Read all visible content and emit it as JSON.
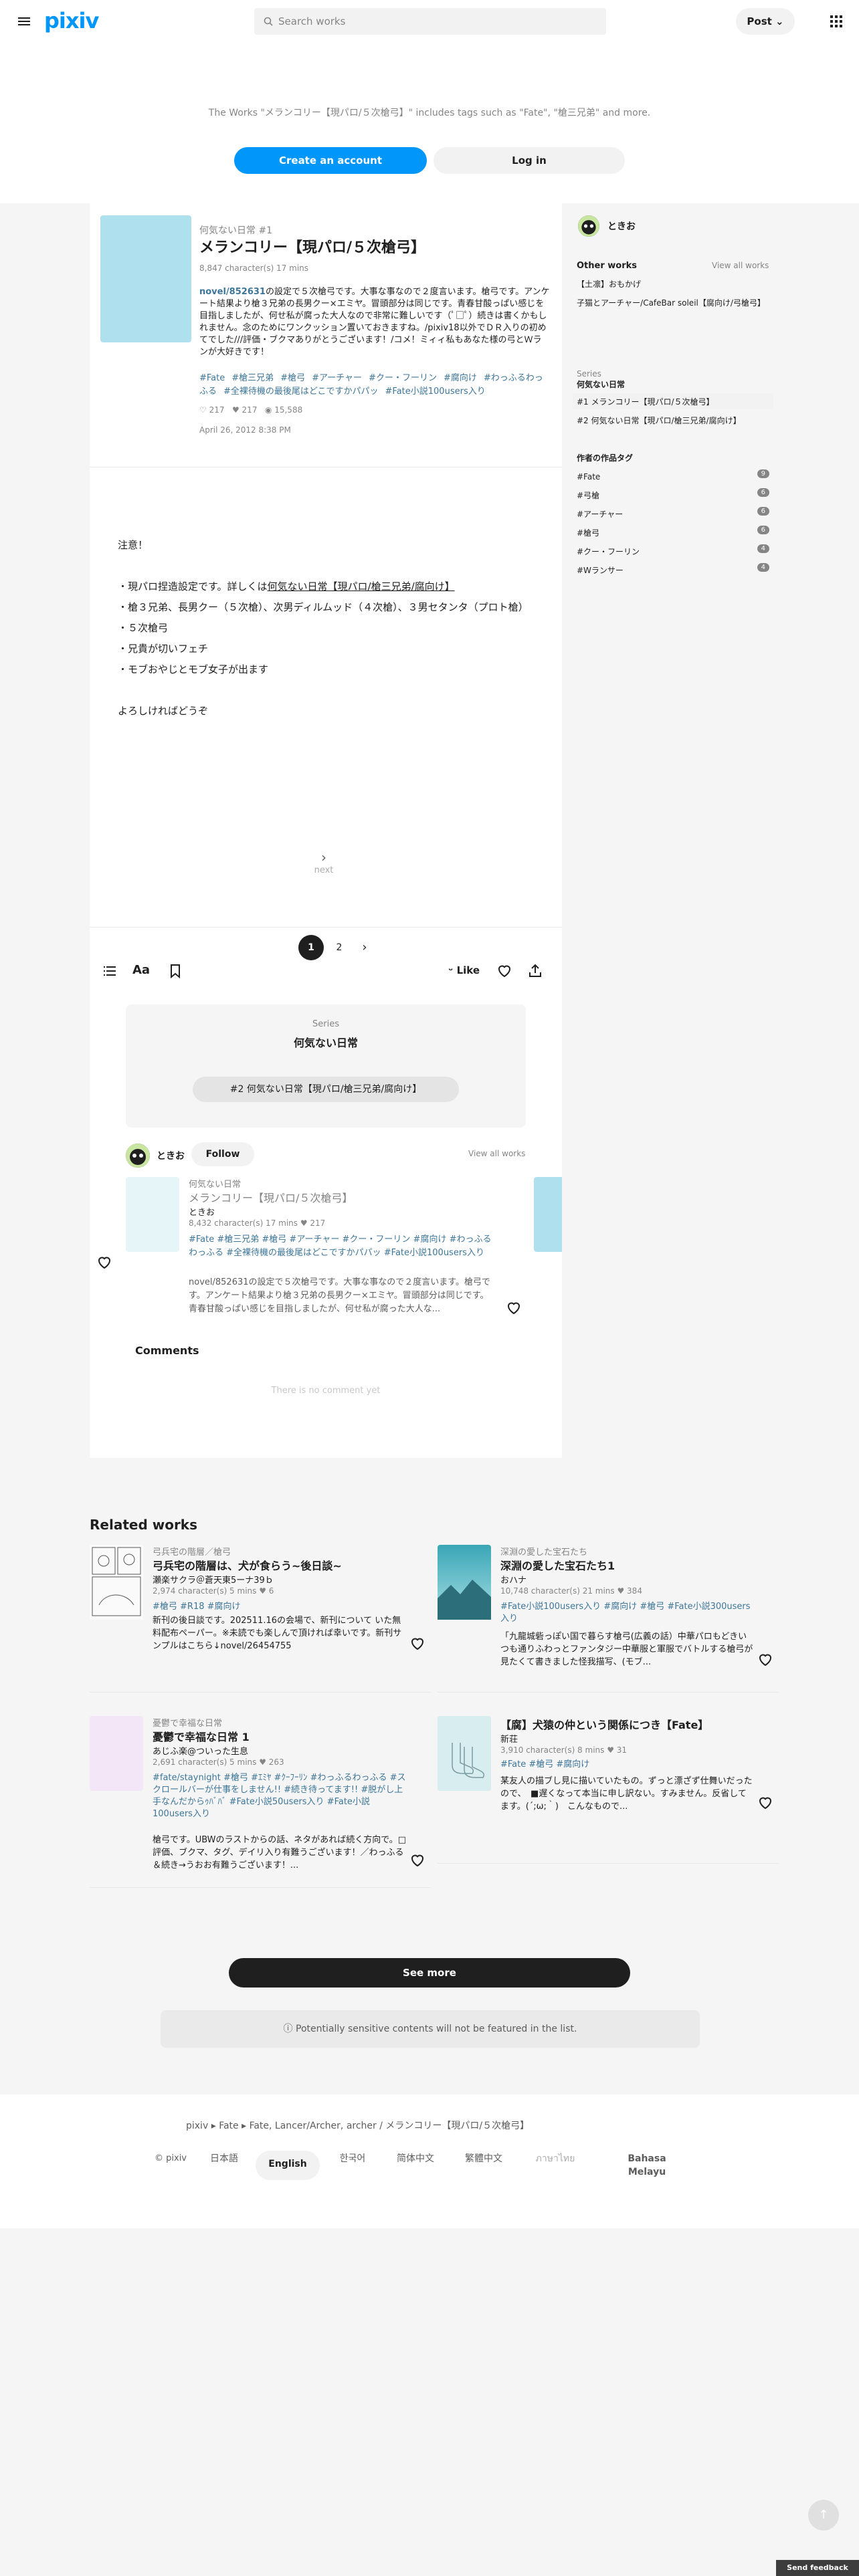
{
  "header": {
    "logo": "pixiv",
    "search_placeholder": "Search works",
    "post_label": "Post"
  },
  "intro": {
    "tagline": "The Works \"メランコリー【現パロ/５次槍弓】\" includes tags such as \"Fate\", \"槍三兄弟\" and more.",
    "create_account": "Create an account",
    "login": "Log in"
  },
  "work": {
    "series_crumb": "何気ない日常 #1",
    "title": "メランコリー【現パロ/５次槍弓】",
    "stats": "8,847 character(s)  17 mins",
    "description_link": "novel/852631",
    "description": "の設定で５次槍弓です。大事な事なので２度言います。槍弓です。アンケート結果より槍３兄弟の長男クー×エミヤ。冒頭部分は同じです。青春甘酸っぱい感じを目指しましたが、何せ私が腐った大人なので非常に難しいです（ﾟ□ﾟ）続きは書くかもしれません。念のためにワンクッション置いておきますね。/pixiv18以外でＤＲ入りの初めてでした///評価・ブクマありがとうございます！/コメ！ミィィ私もあなた様の弓とＷランが大好きです！",
    "tags": [
      "#Fate",
      "#槍三兄弟",
      "#槍弓",
      "#アーチャー",
      "#クー・フーリン",
      "#腐向け",
      "#わっふるわっふる",
      "#全裸待機の最後尾はどこですかパパッ",
      "#Fate小説100users入り"
    ],
    "like_count": "217",
    "bookmark_count": "217",
    "view_count": "15,588",
    "date": "April 26, 2012 8:38 PM",
    "body_lines": [
      "注意！",
      "",
      "・現パロ捏造設定です。詳しくは",
      "・槍３兄弟、長男クー（５次槍）、次男ディルムッド（４次槍）、３男セタンタ（プロト槍）",
      "・５次槍弓",
      "・兄貴が切いフェチ",
      "・モブおやじとモブ女子が出ます",
      "",
      "よろしければどうぞ"
    ],
    "body_link": "何気ない日常【現パロ/槍三兄弟/腐向け】",
    "next_label": "next",
    "page_current": "1",
    "page_next": "2",
    "like_label": "Like"
  },
  "series_box": {
    "label": "Series",
    "name": "何気ない日常",
    "next_item": "#2 何気ない日常【現パロ/槍三兄弟/腐向け】"
  },
  "author": {
    "name": "ときお",
    "follow": "Follow",
    "view_all": "View all works"
  },
  "author_card": {
    "series": "何気ない日常",
    "title": "メランコリー【現パロ/５次槍弓】",
    "author": "ときお",
    "stats": "8,432 character(s)  17 mins  ♥ 217",
    "tags": "#Fate  #槍三兄弟  #槍弓  #アーチャー  #クー・フーリン  #腐向け  #わっふるわっふる  #全裸待機の最後尾はどこですかパパッ  #Fate小説100users入り",
    "excerpt": "novel/852631の設定で５次槍弓です。大事な事なので２度言います。槍弓です。アンケート結果より槍３兄弟の長男クー×エミヤ。冒頭部分は同じです。青春甘酸っぱい感じを目指しましたが、何せ私が腐った大人な..."
  },
  "comments": {
    "title": "Comments",
    "empty": "There is no comment yet"
  },
  "sidebar": {
    "author_name": "ときお",
    "other_works_label": "Other works",
    "view_all": "View all works",
    "other_works": [
      "【土凛】おもかげ",
      "子猫とアーチャー/CafeBar soleil【腐向け/弓槍弓】"
    ],
    "series_label": "Series",
    "series_name": "何気ない日常",
    "series_items": [
      "#1 メランコリー【現パロ/５次槍弓】",
      "#2 何気ない日常【現パロ/槍三兄弟/腐向け】"
    ],
    "tags_label": "作者の作品タグ",
    "tags": [
      {
        "name": "#Fate",
        "count": "9"
      },
      {
        "name": "#弓槍",
        "count": "6"
      },
      {
        "name": "#アーチャー",
        "count": "6"
      },
      {
        "name": "#槍弓",
        "count": "6"
      },
      {
        "name": "#クー・フーリン",
        "count": "4"
      },
      {
        "name": "#Wランサー",
        "count": "4"
      }
    ]
  },
  "related": {
    "title": "Related works",
    "items": [
      {
        "series": "弓兵宅の階層／槍弓",
        "title": "弓兵宅の階層は、犬が食らう~後日談~",
        "author": "瀬楽サクラ＠蒼天東5ーナ39ｂ",
        "stats": "2,974 character(s)  5 mins  ♥ 6",
        "tags": "#槍弓  #R18  #腐向け",
        "excerpt": "新刊の後日談です。202511.16の会場で、新刊について いた無料配布ペーパー。※未読でも楽しんで頂ければ幸いです。新刊サンプルはこちら↓novel/26454755"
      },
      {
        "series": "深淵の愛した宝石たち",
        "title": "深淵の愛した宝石たち1",
        "author": "おハナ",
        "stats": "10,748 character(s)  21 mins  ♥ 384",
        "tags": "#Fate小説100users入り  #腐向け  #槍弓  #Fate小説300users入り",
        "excerpt": "「九龍城砦っぽい国で暮らす槍弓(広義の話）中華パロもどきいつも通りふわっとファンタジー中華服と軍服でバトルする槍弓が見たくて書きました怪我描写、(モブ..."
      },
      {
        "series": "憂鬱で幸福な日常",
        "title": "憂鬱で幸福な日常 1",
        "author": "あじふ楽@ついった生息",
        "stats": "2,691 character(s)  5 mins  ♥ 263",
        "tags": "#fate/staynight  #槍弓  #ｴﾐﾔ  #ｸｰﾌｰﾘﾝ  #わっふるわっふる  #スクロールバーが仕事をしません!!  #続き待ってます!!  #脱がし上手なんだからｩﾊﾞﾊﾞ  #Fate小説50users入り  #Fate小説100users入り",
        "excerpt": "槍弓です。UBWのラストからの話、ネタがあれば続く方向で。□評価、ブクマ、タグ、デイリ入り有難うございます！／わっふる＆続き→うおお有難うございます！..."
      },
      {
        "series": "",
        "title": "【腐】犬猿の仲という関係につき【Fate】",
        "author": "新荘",
        "stats": "3,910 character(s)  8 mins  ♥ 31",
        "tags": "#Fate  #槍弓  #腐向け",
        "excerpt": "某友人の描ブし見に描いていたもの。ずっと漂ざず仕舞いだったので、　■遅くなって本当に申し訳ない。すみません。反省してます。(´;ω;｀)　こんなもので..."
      }
    ]
  },
  "see_more": "See more",
  "sensitive_note": "Potentially sensitive contents will not be featured in the list.",
  "footer": {
    "crumb": [
      "pixiv",
      "Fate",
      "Fate, Lancer/Archer, archer / メランコリー【現パロ/５次槍弓】"
    ],
    "copyright": "© pixiv",
    "languages": [
      "日本語",
      "English",
      "한국어",
      "简体中文",
      "繁體中文",
      "ภาษาไทย",
      "Bahasa Melayu"
    ],
    "active_language": "English"
  },
  "send_feedback": "Send feedback",
  "colors": {
    "brand": "#0096fa",
    "link": "#3d7699",
    "cover": "#aee0ed"
  }
}
